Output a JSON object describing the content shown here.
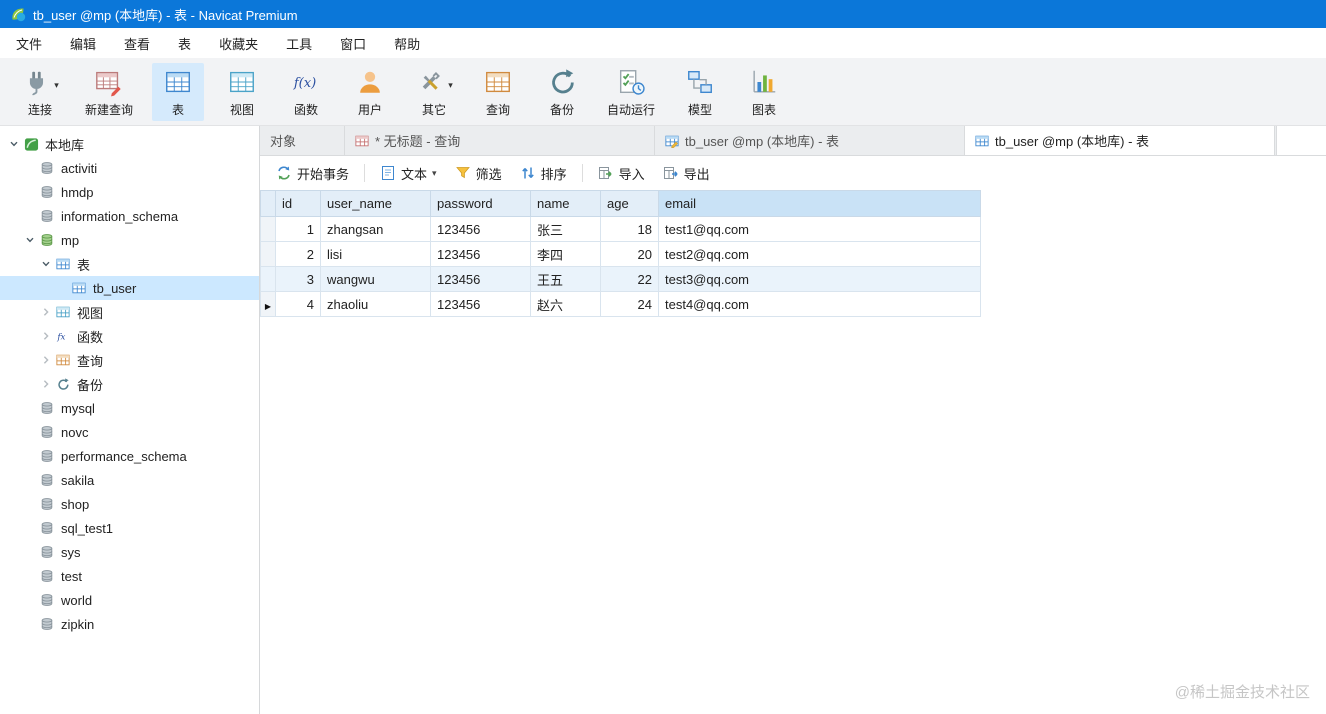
{
  "window": {
    "title": "tb_user @mp (本地库) - 表 - Navicat Premium"
  },
  "menu": {
    "items": [
      {
        "name": "file",
        "label": "文件"
      },
      {
        "name": "edit",
        "label": "编辑"
      },
      {
        "name": "view",
        "label": "查看"
      },
      {
        "name": "table",
        "label": "表"
      },
      {
        "name": "favorites",
        "label": "收藏夹"
      },
      {
        "name": "tools",
        "label": "工具"
      },
      {
        "name": "window",
        "label": "窗口"
      },
      {
        "name": "help",
        "label": "帮助"
      }
    ]
  },
  "toolbar": {
    "items": [
      {
        "name": "connection",
        "label": "连接",
        "icon": "connection-icon",
        "dropdown": true,
        "active": false
      },
      {
        "name": "new-query",
        "label": "新建查询",
        "icon": "new-query-icon",
        "dropdown": false,
        "active": false
      },
      {
        "name": "table",
        "label": "表",
        "icon": "table-icon",
        "dropdown": false,
        "active": true
      },
      {
        "name": "view",
        "label": "视图",
        "icon": "view-icon",
        "dropdown": false,
        "active": false
      },
      {
        "name": "function",
        "label": "函数",
        "icon": "function-icon",
        "dropdown": false,
        "active": false
      },
      {
        "name": "user",
        "label": "用户",
        "icon": "user-icon",
        "dropdown": false,
        "active": false
      },
      {
        "name": "other",
        "label": "其它",
        "icon": "other-icon",
        "dropdown": true,
        "active": false
      },
      {
        "name": "query",
        "label": "查询",
        "icon": "query-icon",
        "dropdown": false,
        "active": false
      },
      {
        "name": "backup",
        "label": "备份",
        "icon": "backup-icon",
        "dropdown": false,
        "active": false
      },
      {
        "name": "automation",
        "label": "自动运行",
        "icon": "automation-icon",
        "dropdown": false,
        "active": false
      },
      {
        "name": "model",
        "label": "模型",
        "icon": "model-icon",
        "dropdown": false,
        "active": false
      },
      {
        "name": "chart",
        "label": "图表",
        "icon": "chart-icon",
        "dropdown": false,
        "active": false
      }
    ]
  },
  "tabs": [
    {
      "name": "objects",
      "label": "对象",
      "icon": null,
      "active": false
    },
    {
      "name": "untitled-query",
      "label": "* 无标题 - 查询",
      "icon": "query-tab-icon",
      "active": false
    },
    {
      "name": "tb-user-table-1",
      "label": "tb_user @mp (本地库) - 表",
      "icon": "table-edit-icon",
      "active": false
    },
    {
      "name": "tb-user-table-2",
      "label": "tb_user @mp (本地库) - 表",
      "icon": "table-tab-icon",
      "active": true
    }
  ],
  "table_toolbar": {
    "items": [
      {
        "name": "begin-transaction",
        "label": "开始事务",
        "icon": "begin-transaction-icon",
        "dropdown": false,
        "sep_after": true
      },
      {
        "name": "text",
        "label": "文本",
        "icon": "text-icon",
        "dropdown": true,
        "sep_after": false
      },
      {
        "name": "filter",
        "label": "筛选",
        "icon": "filter-icon",
        "dropdown": false,
        "sep_after": false
      },
      {
        "name": "sort",
        "label": "排序",
        "icon": "sort-icon",
        "dropdown": false,
        "sep_after": true
      },
      {
        "name": "import",
        "label": "导入",
        "icon": "import-icon",
        "dropdown": false,
        "sep_after": false
      },
      {
        "name": "export",
        "label": "导出",
        "icon": "export-icon",
        "dropdown": false,
        "sep_after": false
      }
    ]
  },
  "grid": {
    "columns": [
      "id",
      "user_name",
      "password",
      "name",
      "age",
      "email"
    ],
    "highlighted_column": "email",
    "hover_row": 3,
    "current_row": 4,
    "rows": [
      [
        "1",
        "zhangsan",
        "123456",
        "张三",
        "18",
        "test1@qq.com"
      ],
      [
        "2",
        "lisi",
        "123456",
        "李四",
        "20",
        "test2@qq.com"
      ],
      [
        "3",
        "wangwu",
        "123456",
        "王五",
        "22",
        "test3@qq.com"
      ],
      [
        "4",
        "zhaoliu",
        "123456",
        "赵六",
        "24",
        "test4@qq.com"
      ]
    ]
  },
  "sidebar": {
    "tree": [
      {
        "name": "local-connection",
        "label": "本地库",
        "depth": 0,
        "icon": "connection-small-icon",
        "arrow": "expanded",
        "selected": false
      },
      {
        "name": "db-activiti",
        "label": "activiti",
        "depth": 1,
        "icon": "database-icon",
        "arrow": "none",
        "selected": false
      },
      {
        "name": "db-hmdp",
        "label": "hmdp",
        "depth": 1,
        "icon": "database-icon",
        "arrow": "none",
        "selected": false
      },
      {
        "name": "db-information-schema",
        "label": "information_schema",
        "depth": 1,
        "icon": "database-icon",
        "arrow": "none",
        "selected": false
      },
      {
        "name": "db-mp",
        "label": "mp",
        "depth": 1,
        "icon": "database-open-icon",
        "arrow": "expanded",
        "selected": false
      },
      {
        "name": "mp-tables",
        "label": "表",
        "depth": 2,
        "icon": "tables-icon",
        "arrow": "expanded",
        "selected": false
      },
      {
        "name": "table-tb-user",
        "label": "tb_user",
        "depth": 3,
        "icon": "table-small-icon",
        "arrow": "none",
        "selected": true
      },
      {
        "name": "mp-views",
        "label": "视图",
        "depth": 2,
        "icon": "views-icon",
        "arrow": "collapsed",
        "selected": false
      },
      {
        "name": "mp-functions",
        "label": "函数",
        "depth": 2,
        "icon": "functions-icon",
        "arrow": "collapsed",
        "selected": false
      },
      {
        "name": "mp-queries",
        "label": "查询",
        "depth": 2,
        "icon": "queries-icon",
        "arrow": "collapsed",
        "selected": false
      },
      {
        "name": "mp-backups",
        "label": "备份",
        "depth": 2,
        "icon": "backups-icon",
        "arrow": "collapsed",
        "selected": false
      },
      {
        "name": "db-mysql",
        "label": "mysql",
        "depth": 1,
        "icon": "database-icon",
        "arrow": "none",
        "selected": false
      },
      {
        "name": "db-novc",
        "label": "novc",
        "depth": 1,
        "icon": "database-icon",
        "arrow": "none",
        "selected": false
      },
      {
        "name": "db-performance-schema",
        "label": "performance_schema",
        "depth": 1,
        "icon": "database-icon",
        "arrow": "none",
        "selected": false
      },
      {
        "name": "db-sakila",
        "label": "sakila",
        "depth": 1,
        "icon": "database-icon",
        "arrow": "none",
        "selected": false
      },
      {
        "name": "db-shop",
        "label": "shop",
        "depth": 1,
        "icon": "database-icon",
        "arrow": "none",
        "selected": false
      },
      {
        "name": "db-sql-test1",
        "label": "sql_test1",
        "depth": 1,
        "icon": "database-icon",
        "arrow": "none",
        "selected": false
      },
      {
        "name": "db-sys",
        "label": "sys",
        "depth": 1,
        "icon": "database-icon",
        "arrow": "none",
        "selected": false
      },
      {
        "name": "db-test",
        "label": "test",
        "depth": 1,
        "icon": "database-icon",
        "arrow": "none",
        "selected": false
      },
      {
        "name": "db-world",
        "label": "world",
        "depth": 1,
        "icon": "database-icon",
        "arrow": "none",
        "selected": false
      },
      {
        "name": "db-zipkin",
        "label": "zipkin",
        "depth": 1,
        "icon": "database-icon",
        "arrow": "none",
        "selected": false
      }
    ]
  },
  "watermark": "@稀土掘金技术社区",
  "colors": {
    "titlebar": "#0b77d9",
    "accent": "#3e87cf",
    "tree_selection": "#cce8ff",
    "toolbar_active": "#d5eafc",
    "header_highlight": "#c9e2f6"
  }
}
